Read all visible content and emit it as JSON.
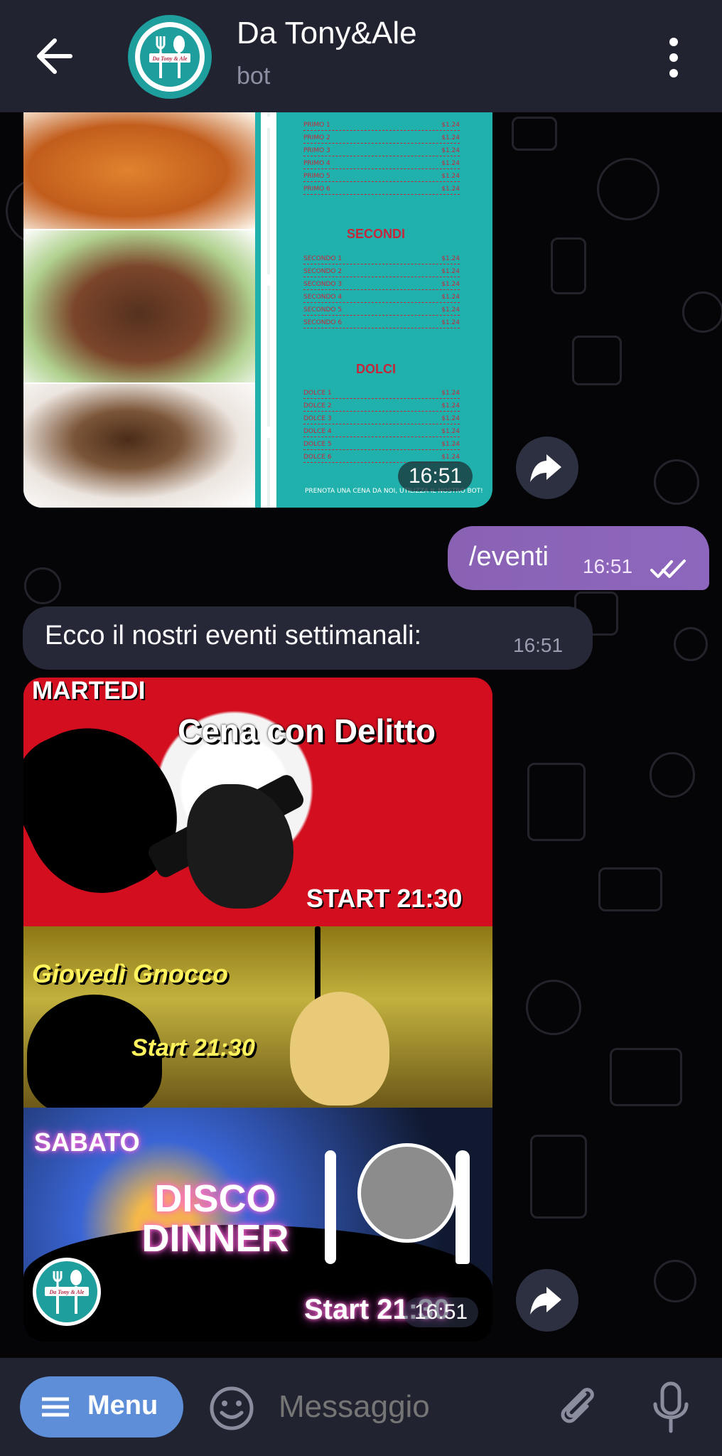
{
  "header": {
    "title": "Da Tony&Ale",
    "subtitle": "bot",
    "avatar_text": "Da Tony & Ale"
  },
  "messages": {
    "menu_image": {
      "timestamp": "16:51",
      "sections": [
        {
          "title": "",
          "items": [
            "PRIMO 1",
            "PRIMO 2",
            "PRIMO 3",
            "PRIMO 4",
            "PRIMO 5",
            "PRIMO 6"
          ],
          "price": "$1.24"
        },
        {
          "title": "SECONDI",
          "items": [
            "SECONDO 1",
            "SECONDO 2",
            "SECONDO 3",
            "SECONDO 4",
            "SECONDO 5",
            "SECONDO 6"
          ],
          "price": "$1.24"
        },
        {
          "title": "DOLCI",
          "items": [
            "DOLCE 1",
            "DOLCE 2",
            "DOLCE 3",
            "DOLCE 4",
            "DOLCE 5",
            "DOLCE 6"
          ],
          "price": "$1.24"
        }
      ],
      "footer": "PRENOTA UNA CENA DA NOI, UTILIZZA IL NOSTRO BOT!"
    },
    "outgoing": {
      "text": "/eventi",
      "timestamp": "16:51",
      "status": "read"
    },
    "incoming": {
      "text": "Ecco il nostri eventi settimanali:",
      "timestamp": "16:51"
    },
    "events_image": {
      "timestamp": "16:51",
      "events": [
        {
          "day": "MARTEDI",
          "name": "Cena con Delitto",
          "start": "START 21:30"
        },
        {
          "day": "Giovedì Gnocco",
          "name": "",
          "start": "Start 21:30"
        },
        {
          "day": "SABATO",
          "name": "DISCO DINNER",
          "start": "Start 21:30"
        }
      ],
      "logo_text": "Da Tony & Ale"
    }
  },
  "composer": {
    "menu_label": "Menu",
    "placeholder": "Messaggio"
  },
  "colors": {
    "header": "#212331",
    "outgoing_bubble": "#8a63b8",
    "incoming_bubble": "#262837",
    "menu_button": "#5f8ed9",
    "teal": "#1e9e9c"
  },
  "icons": {
    "back": "back-arrow-icon",
    "more": "more-vertical-icon",
    "share": "share-icon",
    "emoji": "emoji-icon",
    "attach": "paperclip-icon",
    "microphone": "microphone-icon",
    "menu": "hamburger-menu-icon"
  }
}
